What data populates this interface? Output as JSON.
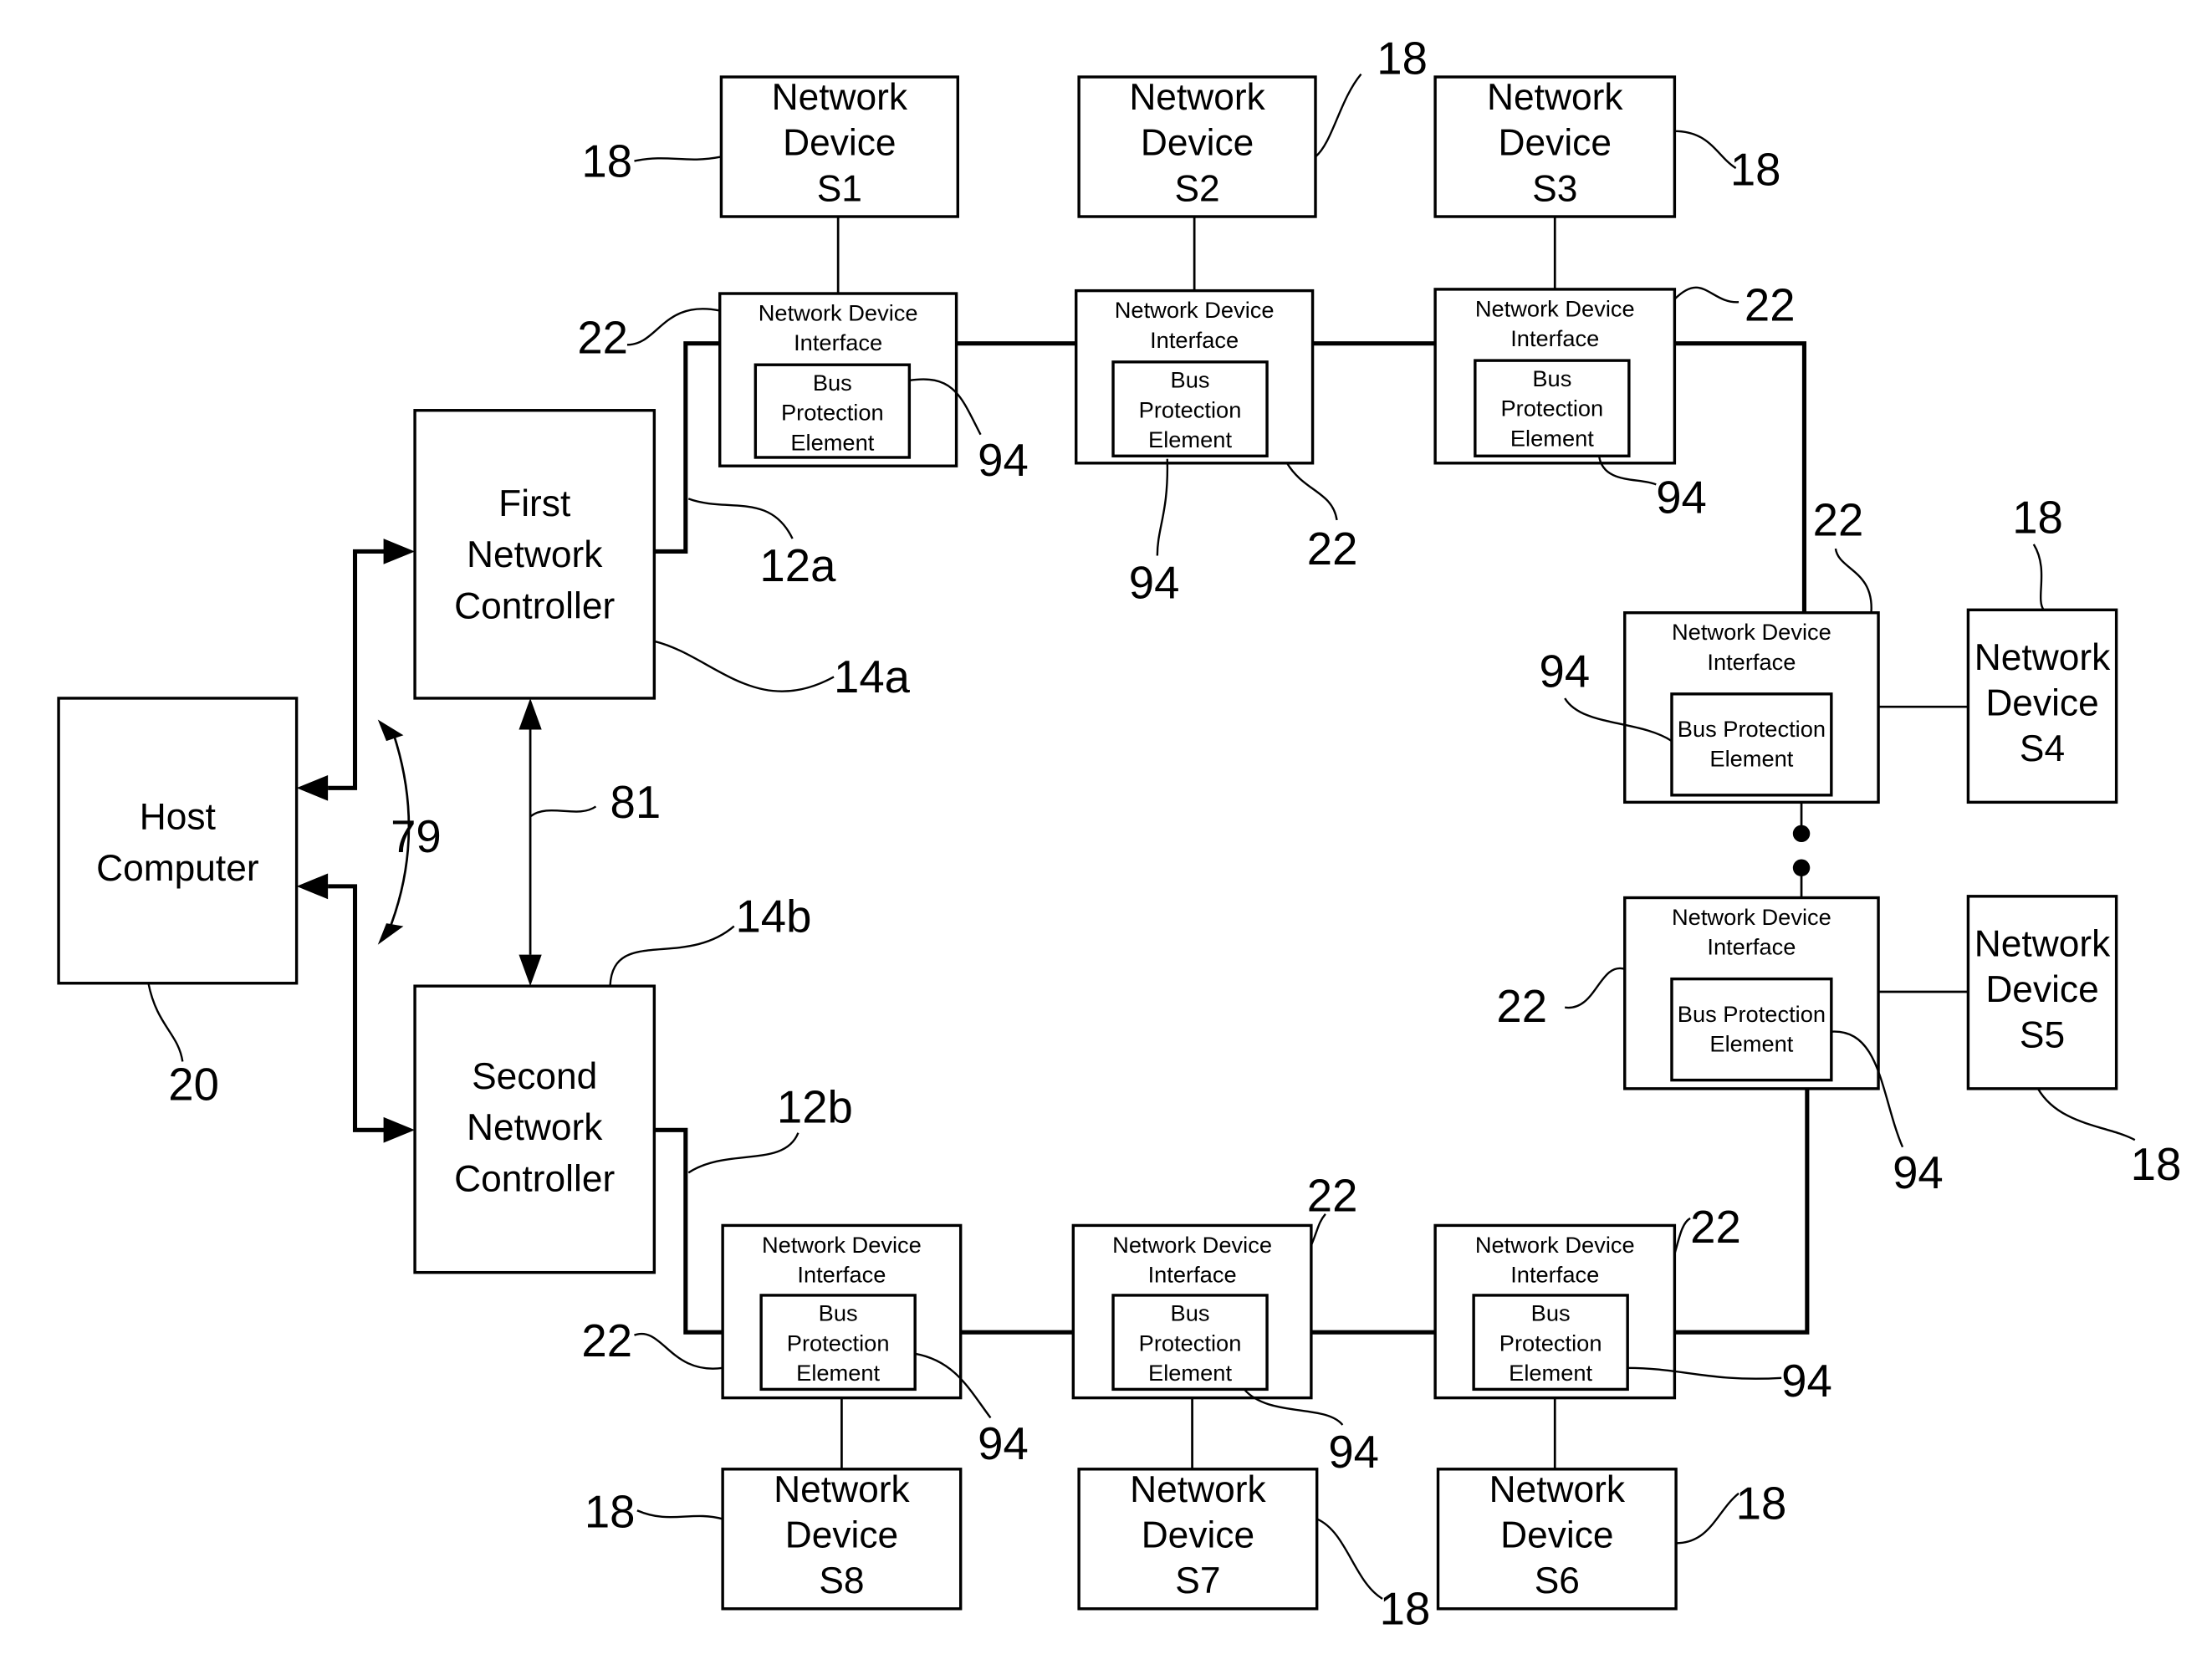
{
  "diagram": {
    "host": {
      "lines": [
        "Host",
        "Computer"
      ],
      "ref": "20"
    },
    "controllers": [
      {
        "id": "first",
        "lines": [
          "First",
          "Network",
          "Controller"
        ],
        "ref": "14a",
        "bus_ref": "12a"
      },
      {
        "id": "second",
        "lines": [
          "Second",
          "Network",
          "Controller"
        ],
        "ref": "14b",
        "bus_ref": "12b"
      }
    ],
    "link_refs": {
      "host_to_controllers": "79",
      "controller_to_controller": "81"
    },
    "interface": {
      "lines": [
        "Network Device",
        "Interface"
      ],
      "ref": "22"
    },
    "protection": {
      "lines3": [
        "Bus",
        "Protection",
        "Element"
      ],
      "lines2": [
        "Bus Protection",
        "Element"
      ],
      "ref": "94"
    },
    "device_lines": [
      "Network",
      "Device"
    ],
    "device_ref": "18",
    "devices": [
      "S1",
      "S2",
      "S3",
      "S4",
      "S5",
      "S6",
      "S7",
      "S8"
    ]
  }
}
